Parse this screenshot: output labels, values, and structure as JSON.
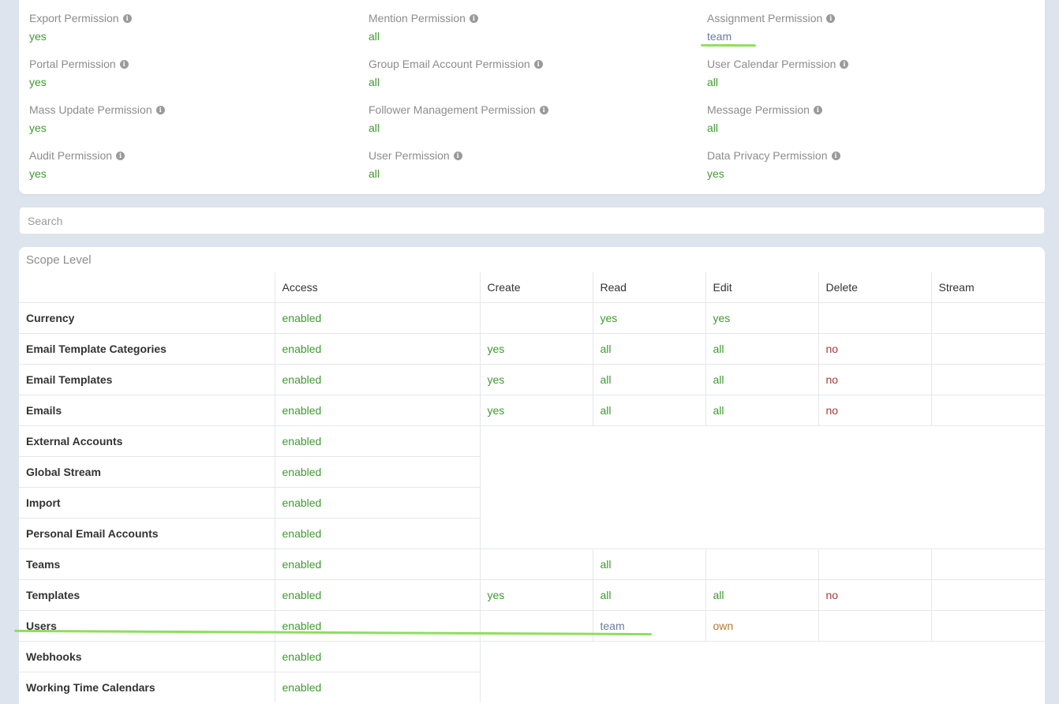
{
  "permissions": {
    "col1": [
      {
        "label": "Export Permission",
        "value": "yes",
        "color": "green"
      },
      {
        "label": "Portal Permission",
        "value": "yes",
        "color": "green"
      },
      {
        "label": "Mass Update Permission",
        "value": "yes",
        "color": "green"
      },
      {
        "label": "Audit Permission",
        "value": "yes",
        "color": "green"
      }
    ],
    "col2": [
      {
        "label": "Mention Permission",
        "value": "all",
        "color": "green"
      },
      {
        "label": "Group Email Account Permission",
        "value": "all",
        "color": "green"
      },
      {
        "label": "Follower Management Permission",
        "value": "all",
        "color": "green"
      },
      {
        "label": "User Permission",
        "value": "all",
        "color": "green"
      }
    ],
    "col3": [
      {
        "label": "Assignment Permission",
        "value": "team",
        "color": "blue"
      },
      {
        "label": "User Calendar Permission",
        "value": "all",
        "color": "green"
      },
      {
        "label": "Message Permission",
        "value": "all",
        "color": "green"
      },
      {
        "label": "Data Privacy Permission",
        "value": "yes",
        "color": "green"
      }
    ]
  },
  "search": {
    "placeholder": "Search"
  },
  "scope": {
    "title": "Scope Level",
    "headers": [
      "Access",
      "Create",
      "Read",
      "Edit",
      "Delete",
      "Stream"
    ],
    "rows": [
      {
        "name": "Currency",
        "access": "enabled",
        "create": "",
        "read": "yes",
        "edit": "yes",
        "delete": "",
        "stream": "",
        "full": true
      },
      {
        "name": "Email Template Categories",
        "access": "enabled",
        "create": "yes",
        "read": "all",
        "edit": "all",
        "delete": "no",
        "stream": "",
        "full": true
      },
      {
        "name": "Email Templates",
        "access": "enabled",
        "create": "yes",
        "read": "all",
        "edit": "all",
        "delete": "no",
        "stream": "",
        "full": true
      },
      {
        "name": "Emails",
        "access": "enabled",
        "create": "yes",
        "read": "all",
        "edit": "all",
        "delete": "no",
        "stream": "",
        "full": true
      },
      {
        "name": "External Accounts",
        "access": "enabled",
        "full": false
      },
      {
        "name": "Global Stream",
        "access": "enabled",
        "full": false
      },
      {
        "name": "Import",
        "access": "enabled",
        "full": false
      },
      {
        "name": "Personal Email Accounts",
        "access": "enabled",
        "full": false
      },
      {
        "name": "Teams",
        "access": "enabled",
        "create": "",
        "read": "all",
        "edit": "",
        "delete": "",
        "stream": "",
        "full": true
      },
      {
        "name": "Templates",
        "access": "enabled",
        "create": "yes",
        "read": "all",
        "edit": "all",
        "delete": "no",
        "stream": "",
        "full": true
      },
      {
        "name": "Users",
        "access": "enabled",
        "create": "",
        "read": "team",
        "edit": "own",
        "delete": "",
        "stream": "",
        "full": true
      },
      {
        "name": "Webhooks",
        "access": "enabled",
        "full": false
      },
      {
        "name": "Working Time Calendars",
        "access": "enabled",
        "full": false
      }
    ]
  },
  "colors": {
    "green": "#3f9a2f",
    "blue": "#6b7b9c",
    "red": "#a53a3a",
    "orange": "#b37a2e",
    "highlight": "#8fde5d",
    "background": "#dde4ee"
  }
}
